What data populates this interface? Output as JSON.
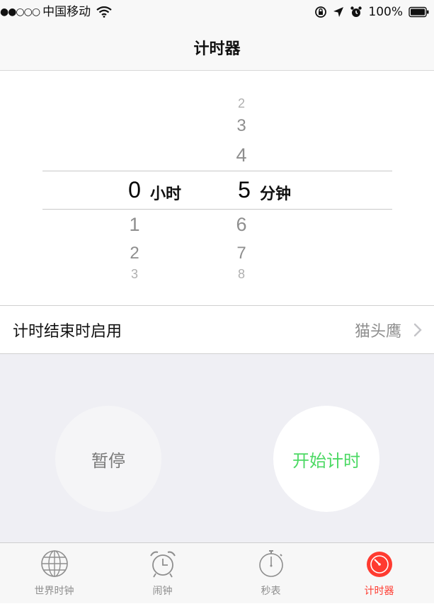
{
  "status_bar": {
    "signal": "●●○○○",
    "carrier": "中国移动",
    "wifi_icon": "wifi-icon",
    "battery": "100%"
  },
  "nav": {
    "title": "计时器"
  },
  "picker": {
    "hours": {
      "above": [],
      "selected": "0",
      "below": [
        "1",
        "2",
        "3"
      ],
      "unit": "小时"
    },
    "minutes": {
      "above": [
        "2",
        "3",
        "4"
      ],
      "selected": "5",
      "below": [
        "6",
        "7",
        "8"
      ],
      "unit": "分钟"
    }
  },
  "setting": {
    "label": "计时结束时启用",
    "value": "猫头鹰"
  },
  "controls": {
    "pause_label": "暂停",
    "start_label": "开始计时"
  },
  "tabs": [
    {
      "label": "世界时钟",
      "icon": "globe-icon",
      "active": false
    },
    {
      "label": "闹钟",
      "icon": "alarm-clock-icon",
      "active": false
    },
    {
      "label": "秒表",
      "icon": "stopwatch-icon",
      "active": false
    },
    {
      "label": "计时器",
      "icon": "timer-icon",
      "active": true
    }
  ],
  "colors": {
    "accent": "#ff3b30",
    "start_green": "#4cd964",
    "inactive_gray": "#8e8e8e"
  }
}
